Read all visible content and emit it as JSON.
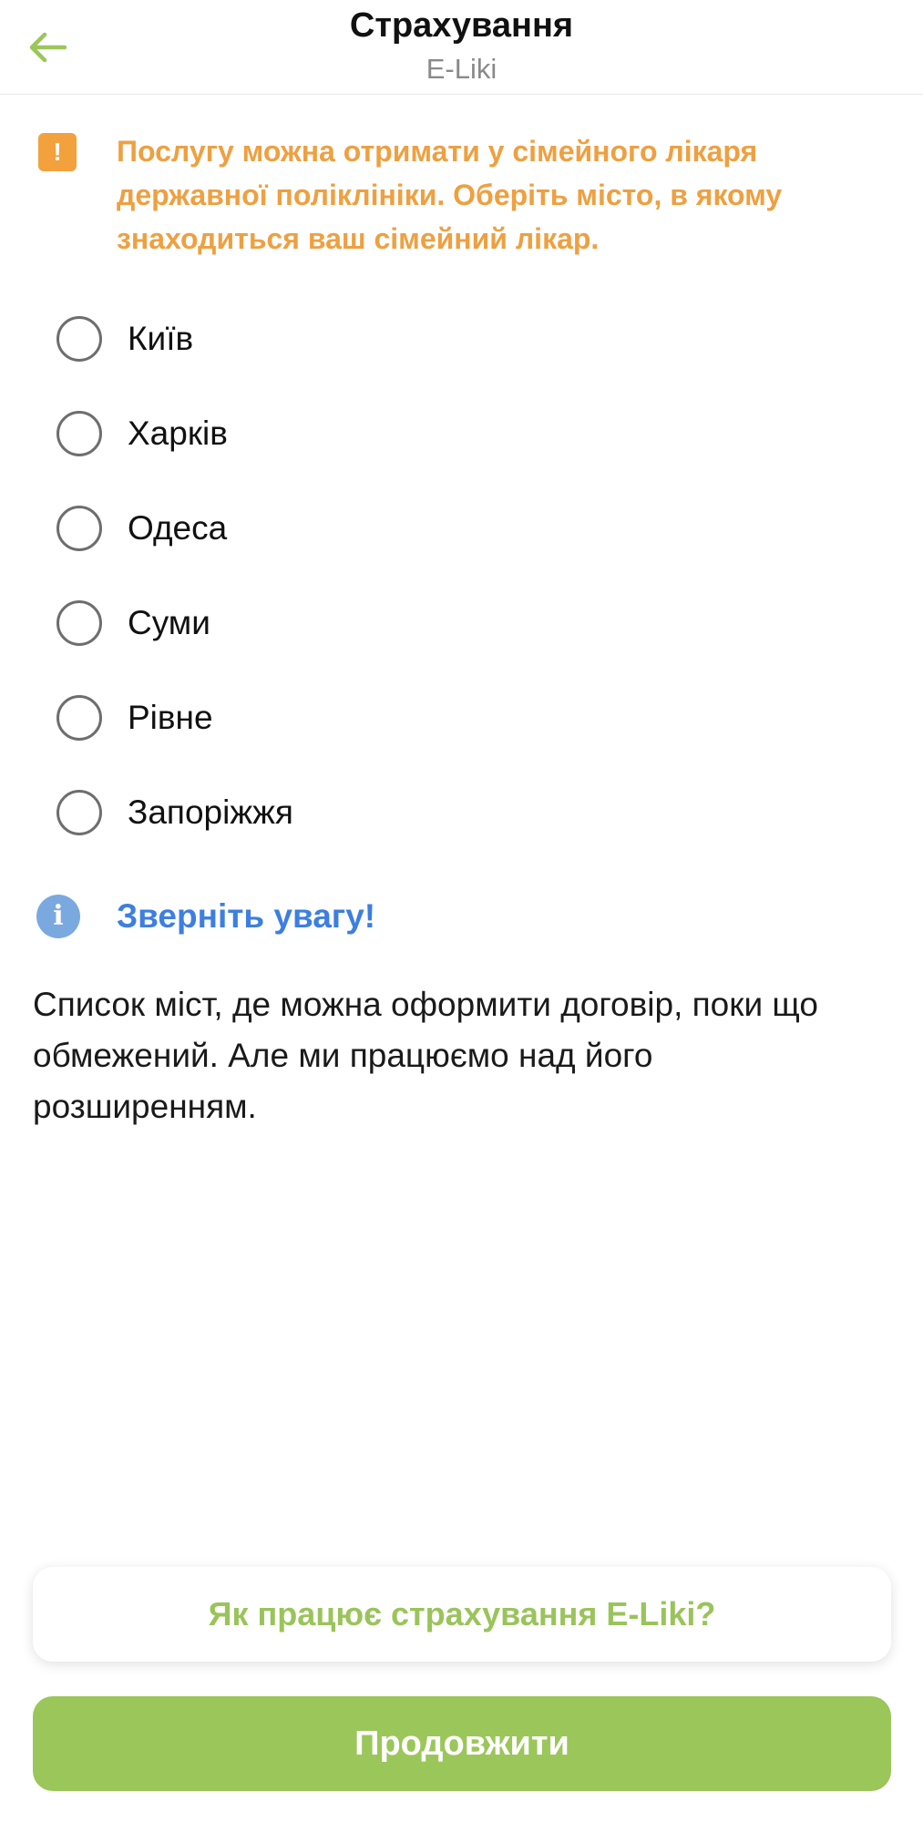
{
  "colors": {
    "accent_green": "#9bc65a",
    "warning_orange": "#eea041",
    "info_blue": "#3d7fe0"
  },
  "header": {
    "back_icon": "arrow-left-icon",
    "title": "Страхування",
    "subtitle": "E-Liki"
  },
  "warning": {
    "icon": "exclamation-icon",
    "icon_glyph": "!",
    "text": "Послугу можна отримати у сімейного лікаря державної поліклініки. Оберіть місто, в якому знаходиться ваш сімейний лікар."
  },
  "cities": [
    {
      "label": "Київ",
      "selected": false
    },
    {
      "label": "Харків",
      "selected": false
    },
    {
      "label": "Одеса",
      "selected": false
    },
    {
      "label": "Суми",
      "selected": false
    },
    {
      "label": "Рівне",
      "selected": false
    },
    {
      "label": "Запоріжжя",
      "selected": false
    }
  ],
  "info": {
    "icon": "info-icon",
    "icon_glyph": "i",
    "title": "Зверніть увагу!",
    "text": "Список міст, де можна оформити договір, поки що обмежений. Але ми працюємо над його розширенням."
  },
  "buttons": {
    "how_it_works": "Як працює страхування E-Liki?",
    "continue": "Продовжити"
  }
}
